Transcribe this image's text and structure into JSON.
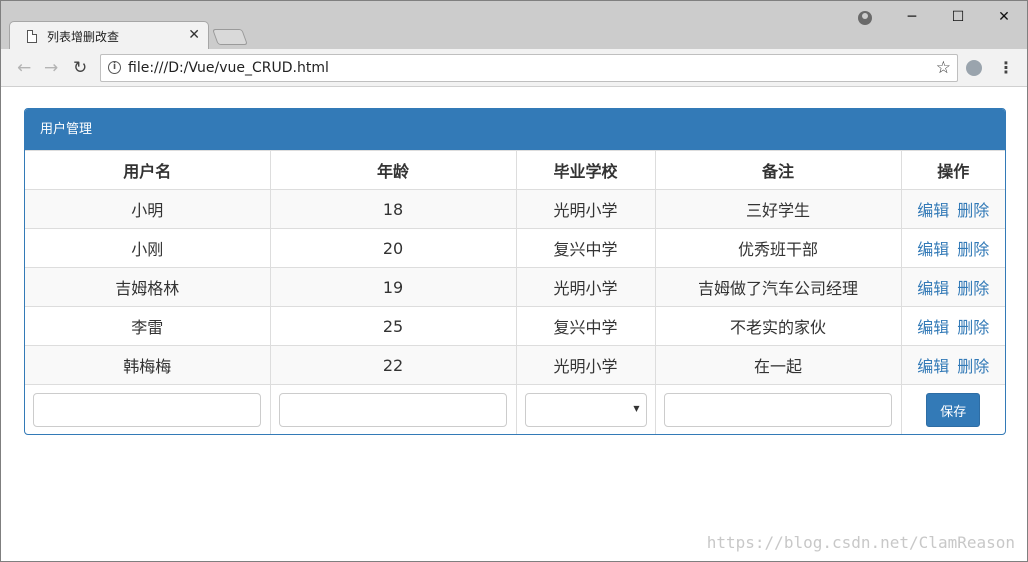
{
  "browser": {
    "tab_title": "列表增删改查",
    "tab_close": "✕",
    "url": "file:///D:/Vue/vue_CRUD.html",
    "win_minimize": "─",
    "win_maximize": "☐",
    "win_close": "✕"
  },
  "panel": {
    "title": "用户管理"
  },
  "table": {
    "headers": [
      "用户名",
      "年龄",
      "毕业学校",
      "备注",
      "操作"
    ],
    "rows": [
      {
        "name": "小明",
        "age": "18",
        "school": "光明小学",
        "remark": "三好学生"
      },
      {
        "name": "小刚",
        "age": "20",
        "school": "复兴中学",
        "remark": "优秀班干部"
      },
      {
        "name": "吉姆格林",
        "age": "19",
        "school": "光明小学",
        "remark": "吉姆做了汽车公司经理"
      },
      {
        "name": "李雷",
        "age": "25",
        "school": "复兴中学",
        "remark": "不老实的家伙"
      },
      {
        "name": "韩梅梅",
        "age": "22",
        "school": "光明小学",
        "remark": "在一起"
      }
    ],
    "edit_label": "编辑",
    "delete_label": "删除"
  },
  "form": {
    "name_value": "",
    "age_value": "",
    "school_selected": "",
    "remark_value": "",
    "save_label": "保存"
  },
  "watermark": "https://blog.csdn.net/ClamReason"
}
